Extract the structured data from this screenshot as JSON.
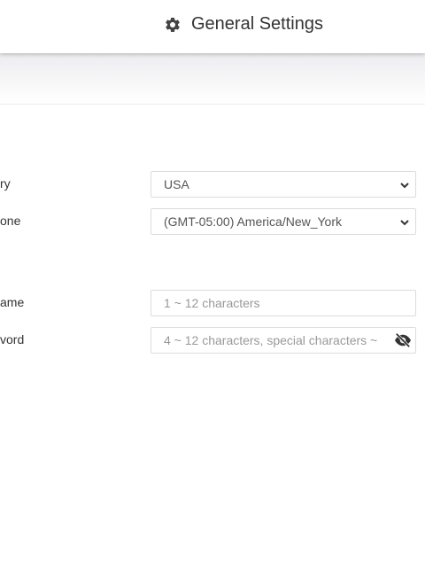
{
  "header": {
    "title": "General Settings",
    "icon": "gear-icon"
  },
  "form": {
    "country": {
      "label": "ry",
      "value": "USA"
    },
    "timezone": {
      "label": "one",
      "value": "(GMT-05:00) America/New_York"
    },
    "username": {
      "label": "ame",
      "placeholder": "1 ~ 12 characters"
    },
    "password": {
      "label": "vord",
      "placeholder": "4 ~ 12 characters, special characters ~"
    }
  }
}
